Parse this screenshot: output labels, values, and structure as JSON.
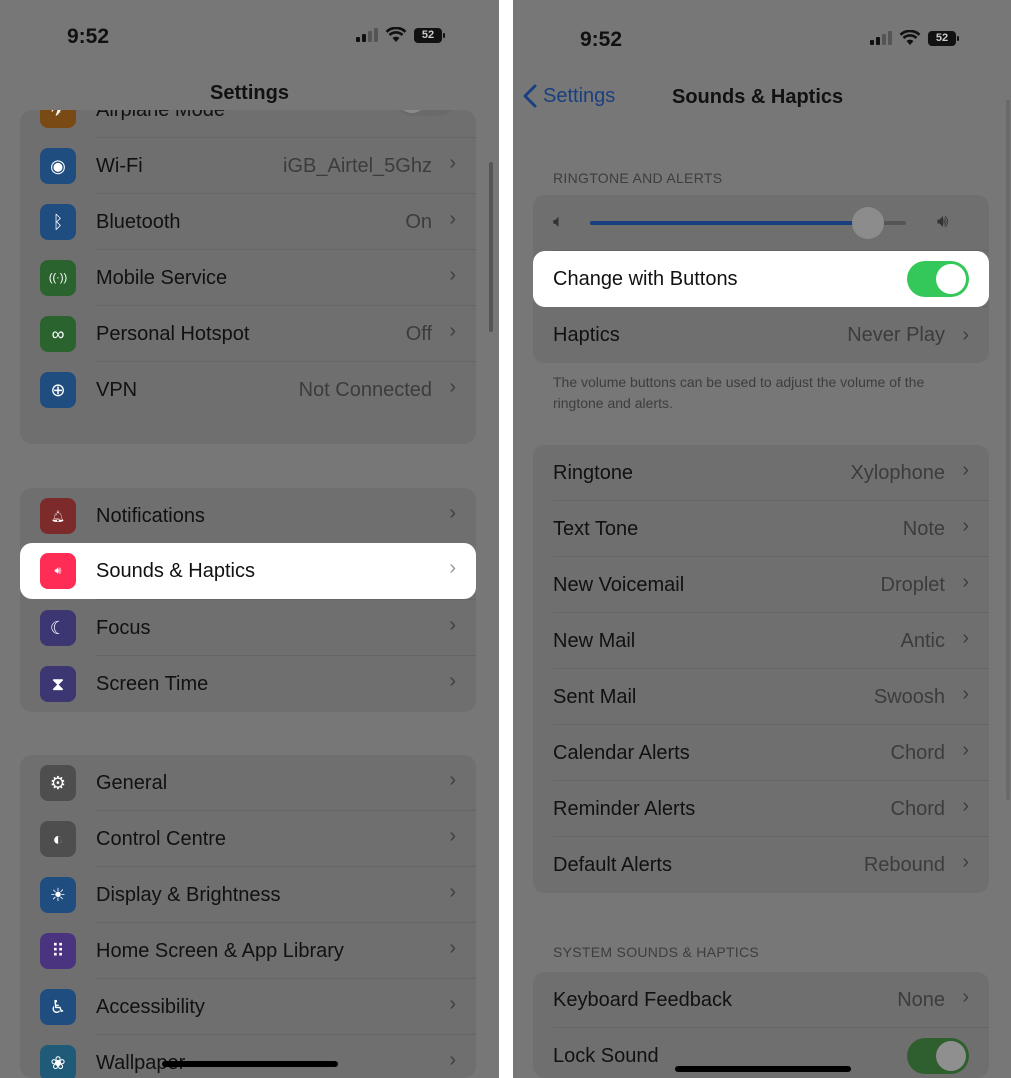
{
  "left": {
    "status": {
      "time": "9:52",
      "battery": "52"
    },
    "title": "Settings",
    "group1": [
      {
        "label": "Airplane Mode",
        "value": "",
        "icon": "airplane-icon",
        "glyph": "✈",
        "color": "#7a4a14",
        "toggle": "off"
      },
      {
        "label": "Wi-Fi",
        "value": "iGB_Airtel_5Ghz",
        "icon": "wifi-icon",
        "glyph": "◉",
        "color": "#1f4d80"
      },
      {
        "label": "Bluetooth",
        "value": "On",
        "icon": "bluetooth-icon",
        "glyph": "ᛒ",
        "color": "#1f4d80"
      },
      {
        "label": "Mobile Service",
        "value": "",
        "icon": "antenna-icon",
        "glyph": "((·))",
        "color": "#2a632d"
      },
      {
        "label": "Personal Hotspot",
        "value": "Off",
        "icon": "hotspot-icon",
        "glyph": "∞",
        "color": "#2a632d"
      },
      {
        "label": "VPN",
        "value": "Not Connected",
        "icon": "vpn-globe-icon",
        "glyph": "⊕",
        "color": "#1f4d80"
      }
    ],
    "group2": [
      {
        "label": "Notifications",
        "value": "",
        "icon": "notifications-bell-icon",
        "glyph": "🔔︎",
        "color": "#7c2a2a"
      },
      {
        "label": "Sounds & Haptics",
        "value": "",
        "icon": "speaker-icon",
        "glyph": "🔊︎",
        "color": "#ff2d55"
      },
      {
        "label": "Focus",
        "value": "",
        "icon": "moon-icon",
        "glyph": "☾",
        "color": "#3c3773"
      },
      {
        "label": "Screen Time",
        "value": "",
        "icon": "hourglass-icon",
        "glyph": "⧗",
        "color": "#3c3773"
      }
    ],
    "group3": [
      {
        "label": "General",
        "value": "",
        "icon": "gear-icon",
        "glyph": "⚙",
        "color": "#4e4e4e"
      },
      {
        "label": "Control Centre",
        "value": "",
        "icon": "switches-icon",
        "glyph": "◐",
        "color": "#4e4e4e"
      },
      {
        "label": "Display & Brightness",
        "value": "",
        "icon": "sun-icon",
        "glyph": "☀",
        "color": "#1f4d80"
      },
      {
        "label": "Home Screen & App Library",
        "value": "",
        "icon": "app-grid-icon",
        "glyph": "⠿",
        "color": "#4a3480"
      },
      {
        "label": "Accessibility",
        "value": "",
        "icon": "accessibility-icon",
        "glyph": "♿︎",
        "color": "#1f4d80"
      },
      {
        "label": "Wallpaper",
        "value": "",
        "icon": "flower-icon",
        "glyph": "❀",
        "color": "#1f5a78"
      }
    ]
  },
  "right": {
    "status": {
      "time": "9:52",
      "battery": "52"
    },
    "back_label": "Settings",
    "title": "Sounds & Haptics",
    "section1_header": "RINGTONE AND ALERTS",
    "volume_level": 0.88,
    "change_with_buttons": {
      "label": "Change with Buttons",
      "state": "on"
    },
    "haptics": {
      "label": "Haptics",
      "value": "Never Play"
    },
    "footnote": "The volume buttons can be used to adjust the volume of the ringtone and alerts.",
    "tones": [
      {
        "label": "Ringtone",
        "value": "Xylophone"
      },
      {
        "label": "Text Tone",
        "value": "Note"
      },
      {
        "label": "New Voicemail",
        "value": "Droplet"
      },
      {
        "label": "New Mail",
        "value": "Antic"
      },
      {
        "label": "Sent Mail",
        "value": "Swoosh"
      },
      {
        "label": "Calendar Alerts",
        "value": "Chord"
      },
      {
        "label": "Reminder Alerts",
        "value": "Chord"
      },
      {
        "label": "Default Alerts",
        "value": "Rebound"
      }
    ],
    "section2_header": "SYSTEM SOUNDS & HAPTICS",
    "system": [
      {
        "label": "Keyboard Feedback",
        "value": "None"
      },
      {
        "label": "Lock Sound",
        "value": "",
        "toggle": "on"
      }
    ]
  }
}
